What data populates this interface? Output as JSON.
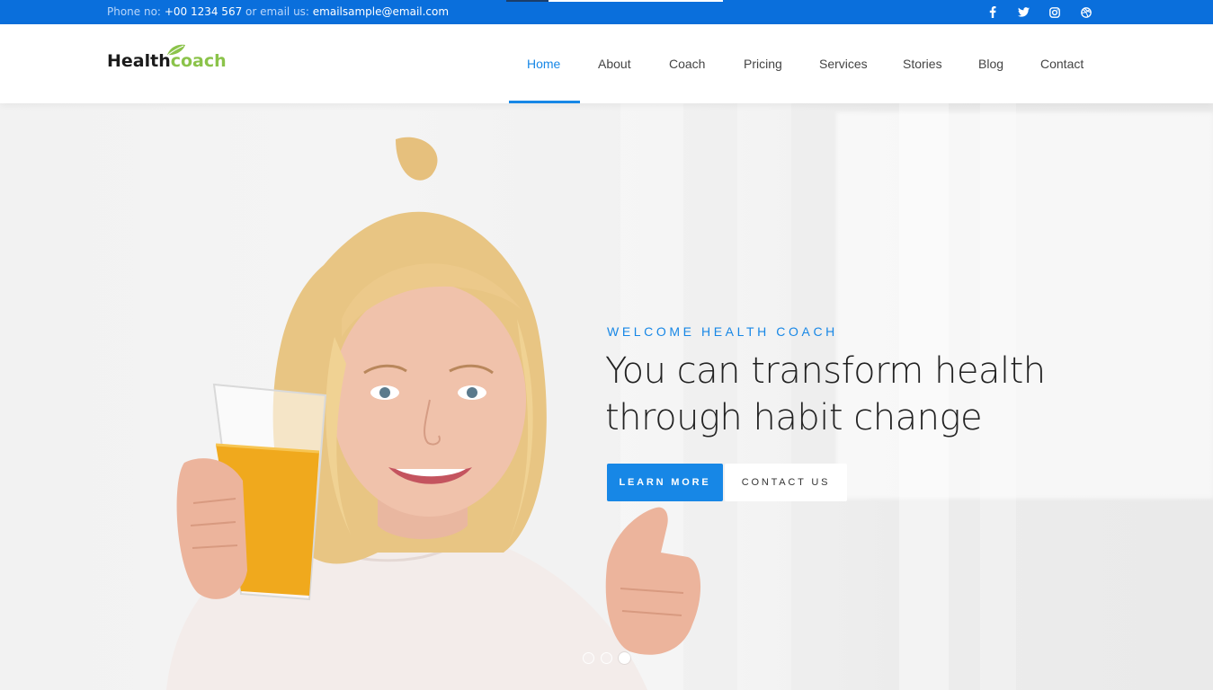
{
  "topbar": {
    "phone_label": "Phone no:",
    "phone": "+00 1234 567",
    "or": "or",
    "email_label": "email us:",
    "email": "emailsample@email.com",
    "social": [
      {
        "icon": "facebook-icon"
      },
      {
        "icon": "twitter-icon"
      },
      {
        "icon": "instagram-icon"
      },
      {
        "icon": "dribbble-icon"
      }
    ]
  },
  "header": {
    "logo_part1": "Health",
    "logo_part2": "coach",
    "nav": [
      {
        "label": "Home",
        "active": true
      },
      {
        "label": "About"
      },
      {
        "label": "Coach"
      },
      {
        "label": "Pricing"
      },
      {
        "label": "Services"
      },
      {
        "label": "Stories"
      },
      {
        "label": "Blog"
      },
      {
        "label": "Contact"
      }
    ]
  },
  "hero": {
    "eyebrow": "WELCOME HEALTH COACH",
    "headline": "You can transform health through habit change",
    "primary_button": "LEARN MORE",
    "secondary_button": "CONTACT US",
    "slides": 3,
    "active_slide": 3
  },
  "colors": {
    "topbar": "#0a6fdc",
    "accent": "#1787e6",
    "logo_green": "#8bc34a"
  }
}
